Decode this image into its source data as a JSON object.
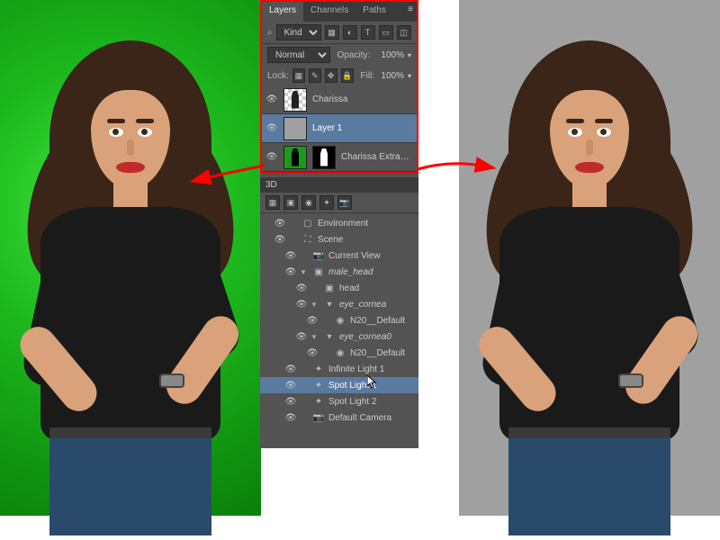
{
  "layers_panel": {
    "tabs": [
      "Layers",
      "Channels",
      "Paths"
    ],
    "active_tab": 0,
    "filter_kind_label": "Kind",
    "blend_mode": "Normal",
    "opacity_label": "Opacity:",
    "opacity_value": "100%",
    "lock_label": "Lock:",
    "fill_label": "Fill:",
    "fill_value": "100%",
    "layers": [
      {
        "name": "Charissa",
        "visible": true,
        "selected": false,
        "thumb": "trans-silh"
      },
      {
        "name": "Layer 1",
        "visible": true,
        "selected": true,
        "thumb": "solid"
      },
      {
        "name": "Charissa Extracted",
        "visible": true,
        "selected": false,
        "thumb": "green-silh",
        "mask": true
      }
    ]
  },
  "panel_3d": {
    "title": "3D",
    "nodes": [
      {
        "name": "Environment",
        "indent": 1,
        "visible": true,
        "icon": "picture",
        "twisty": ""
      },
      {
        "name": "Scene",
        "indent": 1,
        "visible": true,
        "icon": "scene",
        "twisty": ""
      },
      {
        "name": "Current View",
        "indent": 2,
        "visible": true,
        "icon": "camera",
        "twisty": ""
      },
      {
        "name": "male_head",
        "indent": 2,
        "visible": true,
        "icon": "mesh",
        "twisty": "▼",
        "italic": true
      },
      {
        "name": "head",
        "indent": 3,
        "visible": true,
        "icon": "mesh",
        "twisty": ""
      },
      {
        "name": "eye_cornea",
        "indent": 3,
        "visible": true,
        "icon": "group",
        "twisty": "▼",
        "italic": true
      },
      {
        "name": "N20__Default",
        "indent": 4,
        "visible": true,
        "icon": "material",
        "twisty": ""
      },
      {
        "name": "eye_cornea0",
        "indent": 3,
        "visible": true,
        "icon": "group",
        "twisty": "▼",
        "italic": true
      },
      {
        "name": "N20__Default",
        "indent": 4,
        "visible": true,
        "icon": "material",
        "twisty": ""
      },
      {
        "name": "Infinite Light 1",
        "indent": 2,
        "visible": true,
        "icon": "light",
        "twisty": ""
      },
      {
        "name": "Spot Light 1",
        "indent": 2,
        "visible": true,
        "icon": "light",
        "twisty": "",
        "selected": true
      },
      {
        "name": "Spot Light 2",
        "indent": 2,
        "visible": true,
        "icon": "light",
        "twisty": ""
      },
      {
        "name": "Default Camera",
        "indent": 2,
        "visible": true,
        "icon": "camera",
        "twisty": ""
      }
    ]
  },
  "arrows": {
    "left_target": "green_bg",
    "right_target": "gray_bg"
  },
  "colors": {
    "green": "#1a9a1a",
    "gray": "#a0a0a0",
    "accent_red": "#ff0000",
    "selection": "#5a7aa0"
  }
}
